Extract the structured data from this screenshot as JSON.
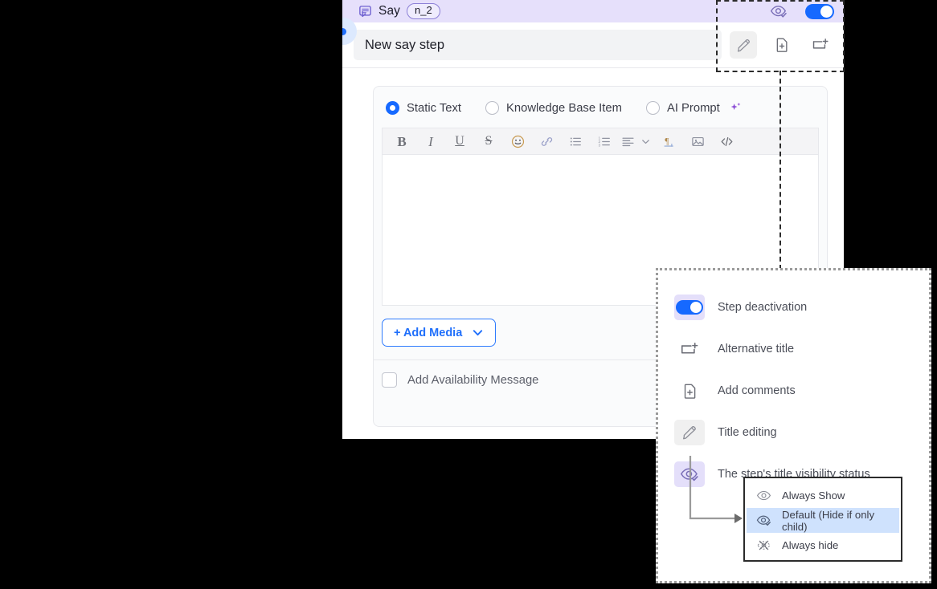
{
  "step_panel": {
    "header": {
      "icon": "say-message-icon",
      "title": "Say",
      "node_badge": "n_2",
      "visibility_icon": "eye-check-icon",
      "activation_toggle": "toggle-on",
      "header_bg": "#e6e0fb"
    },
    "title_row": {
      "value": "New say step",
      "placeholder": "New say step",
      "actions": [
        {
          "name": "title-editing",
          "icon": "pencil-icon",
          "active": true
        },
        {
          "name": "add-comments",
          "icon": "file-plus-icon",
          "active": false
        },
        {
          "name": "alternative-title",
          "icon": "alt-title-icon",
          "active": false
        }
      ]
    },
    "source_options": [
      {
        "label": "Static Text",
        "selected": true
      },
      {
        "label": "Knowledge Base Item",
        "selected": false
      },
      {
        "label": "AI Prompt",
        "selected": false,
        "icon": "sparkle-icon"
      }
    ],
    "editor_toolbar": [
      {
        "name": "bold-icon",
        "glyph": "B"
      },
      {
        "name": "italic-icon",
        "glyph": "I"
      },
      {
        "name": "underline-icon",
        "glyph": "U"
      },
      {
        "name": "strikethrough-icon",
        "glyph": "S"
      },
      {
        "name": "emoji-icon",
        "glyph": "emoji"
      },
      {
        "name": "link-icon",
        "glyph": "link"
      },
      {
        "name": "bulleted-list-icon",
        "glyph": "ul"
      },
      {
        "name": "numbered-list-icon",
        "glyph": "ol"
      },
      {
        "name": "align-icon",
        "glyph": "align"
      },
      {
        "name": "chevron-down-icon",
        "glyph": "chevron"
      },
      {
        "name": "paragraph-indent-icon",
        "glyph": "pilcrow"
      },
      {
        "name": "image-icon",
        "glyph": "image"
      },
      {
        "name": "code-icon",
        "glyph": "code"
      }
    ],
    "editor_content": "",
    "add_media_label": "+ Add Media",
    "add_media_chevron": "chevron-down-icon",
    "availability": {
      "label": "Add Availability Message",
      "checked": false
    }
  },
  "legend": {
    "items": [
      {
        "icon": "toggle-on-icon",
        "label": "Step deactivation",
        "bg": "violet"
      },
      {
        "icon": "alt-title-icon",
        "label": "Alternative title",
        "bg": "none"
      },
      {
        "icon": "file-plus-icon",
        "label": "Add comments",
        "bg": "none"
      },
      {
        "icon": "pencil-icon",
        "label": "Title editing",
        "bg": "gray"
      },
      {
        "icon": "eye-check-icon",
        "label": "The step's title visibility status",
        "bg": "violet"
      }
    ]
  },
  "visibility_menu": {
    "items": [
      {
        "icon": "eye-icon",
        "label": "Always Show",
        "selected": false
      },
      {
        "icon": "eye-check-icon",
        "label": "Default (Hide if only child)",
        "selected": true
      },
      {
        "icon": "eye-hidden-icon",
        "label": "Always hide",
        "selected": false
      }
    ]
  },
  "colors": {
    "accent_blue": "#1669ff",
    "header_violet": "#e6e0fb",
    "menu_selected": "#cfe2fd",
    "icon_gray": "#7d7f88"
  }
}
